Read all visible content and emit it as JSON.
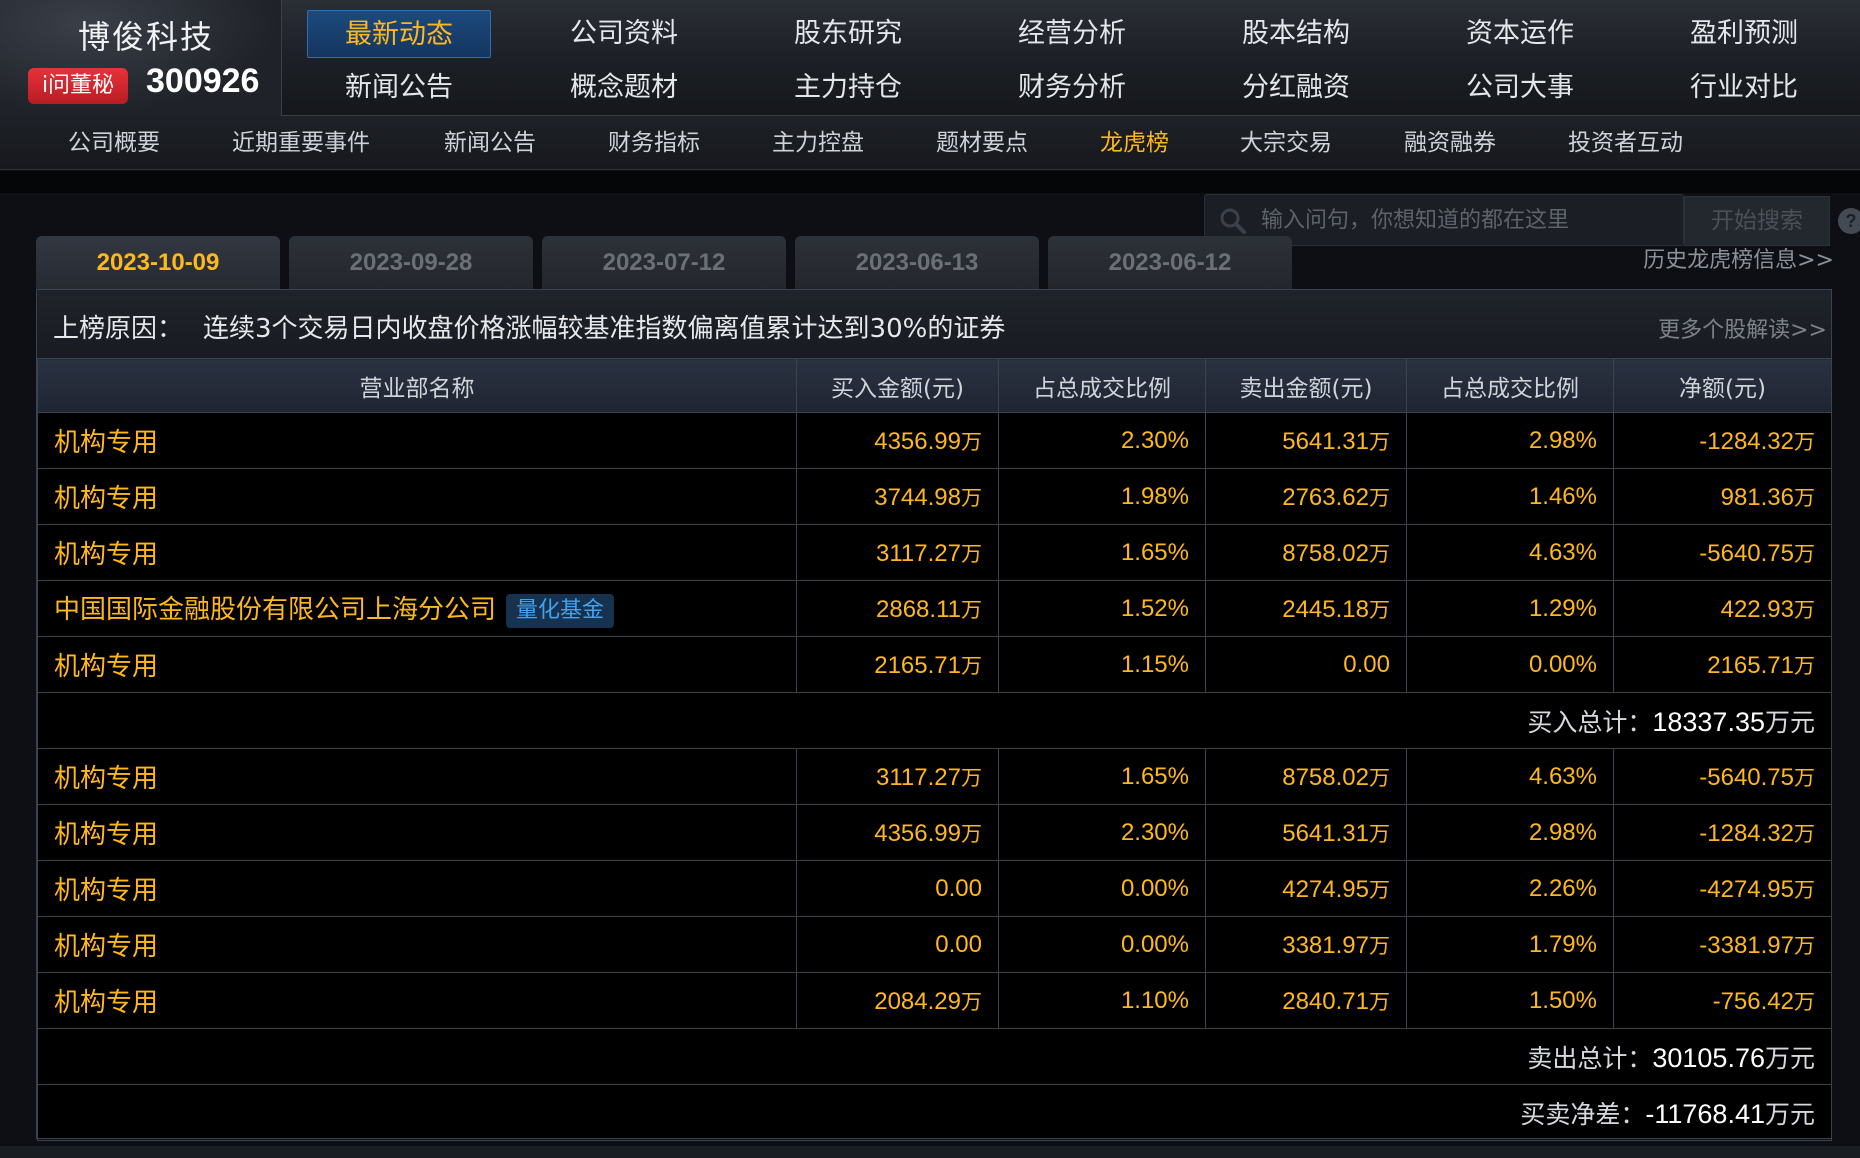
{
  "brand": {
    "company_name": "博俊科技",
    "badge": "i问董秘",
    "stock_code": "300926"
  },
  "main_nav": [
    {
      "label": "最新动态",
      "active": true
    },
    {
      "label": "公司资料"
    },
    {
      "label": "股东研究"
    },
    {
      "label": "经营分析"
    },
    {
      "label": "股本结构"
    },
    {
      "label": "资本运作"
    },
    {
      "label": "盈利预测"
    },
    {
      "label": "新闻公告"
    },
    {
      "label": "概念题材"
    },
    {
      "label": "主力持仓"
    },
    {
      "label": "财务分析"
    },
    {
      "label": "分红融资"
    },
    {
      "label": "公司大事"
    },
    {
      "label": "行业对比"
    }
  ],
  "sub_nav": [
    {
      "label": "公司概要"
    },
    {
      "label": "近期重要事件"
    },
    {
      "label": "新闻公告"
    },
    {
      "label": "财务指标"
    },
    {
      "label": "主力控盘"
    },
    {
      "label": "题材要点"
    },
    {
      "label": "龙虎榜",
      "active": true
    },
    {
      "label": "大宗交易"
    },
    {
      "label": "融资融券"
    },
    {
      "label": "投资者互动"
    }
  ],
  "search": {
    "placeholder": "输入问句，你想知道的都在这里",
    "button": "开始搜索",
    "help": "?"
  },
  "history_link": "历史龙虎榜信息>>",
  "date_tabs": [
    "2023-10-09",
    "2023-09-28",
    "2023-07-12",
    "2023-06-13",
    "2023-06-12"
  ],
  "reason": {
    "label": "上榜原因：",
    "text": "连续3个交易日内收盘价格涨幅较基准指数偏离值累计达到30%的证券",
    "more": "更多个股解读>>"
  },
  "table": {
    "headers": [
      "营业部名称",
      "买入金额(元)",
      "占总成交比例",
      "卖出金额(元)",
      "占总成交比例",
      "净额(元)"
    ],
    "buy_rows": [
      {
        "name": "机构专用",
        "buy": "4356.99",
        "buy_unit": "万",
        "buy_pct": "2.30%",
        "sell": "5641.31",
        "sell_unit": "万",
        "sell_pct": "2.98%",
        "net": "-1284.32",
        "net_unit": "万"
      },
      {
        "name": "机构专用",
        "buy": "3744.98",
        "buy_unit": "万",
        "buy_pct": "1.98%",
        "sell": "2763.62",
        "sell_unit": "万",
        "sell_pct": "1.46%",
        "net": "981.36",
        "net_unit": "万"
      },
      {
        "name": "机构专用",
        "buy": "3117.27",
        "buy_unit": "万",
        "buy_pct": "1.65%",
        "sell": "8758.02",
        "sell_unit": "万",
        "sell_pct": "4.63%",
        "net": "-5640.75",
        "net_unit": "万"
      },
      {
        "name": "中国国际金融股份有限公司上海分公司",
        "tag": "量化基金",
        "buy": "2868.11",
        "buy_unit": "万",
        "buy_pct": "1.52%",
        "sell": "2445.18",
        "sell_unit": "万",
        "sell_pct": "1.29%",
        "net": "422.93",
        "net_unit": "万"
      },
      {
        "name": "机构专用",
        "buy": "2165.71",
        "buy_unit": "万",
        "buy_pct": "1.15%",
        "sell": "0.00",
        "sell_unit": "",
        "sell_pct": "0.00%",
        "net": "2165.71",
        "net_unit": "万"
      }
    ],
    "buy_total": {
      "label": "买入总计：",
      "value": "18337.35",
      "unit": "万元"
    },
    "sell_rows": [
      {
        "name": "机构专用",
        "buy": "3117.27",
        "buy_unit": "万",
        "buy_pct": "1.65%",
        "sell": "8758.02",
        "sell_unit": "万",
        "sell_pct": "4.63%",
        "net": "-5640.75",
        "net_unit": "万"
      },
      {
        "name": "机构专用",
        "buy": "4356.99",
        "buy_unit": "万",
        "buy_pct": "2.30%",
        "sell": "5641.31",
        "sell_unit": "万",
        "sell_pct": "2.98%",
        "net": "-1284.32",
        "net_unit": "万"
      },
      {
        "name": "机构专用",
        "buy": "0.00",
        "buy_unit": "",
        "buy_pct": "0.00%",
        "sell": "4274.95",
        "sell_unit": "万",
        "sell_pct": "2.26%",
        "net": "-4274.95",
        "net_unit": "万"
      },
      {
        "name": "机构专用",
        "buy": "0.00",
        "buy_unit": "",
        "buy_pct": "0.00%",
        "sell": "3381.97",
        "sell_unit": "万",
        "sell_pct": "1.79%",
        "net": "-3381.97",
        "net_unit": "万"
      },
      {
        "name": "机构专用",
        "buy": "2084.29",
        "buy_unit": "万",
        "buy_pct": "1.10%",
        "sell": "2840.71",
        "sell_unit": "万",
        "sell_pct": "1.50%",
        "net": "-756.42",
        "net_unit": "万"
      }
    ],
    "sell_total": {
      "label": "卖出总计：",
      "value": "30105.76",
      "unit": "万元"
    },
    "net_diff": {
      "label": "买卖净差：",
      "value": "-11768.41",
      "unit": "万元"
    }
  },
  "colors": {
    "accent": "#ffb81c",
    "tag_text": "#3fa3f2",
    "active_nav_bg": "#1c4a7d"
  }
}
